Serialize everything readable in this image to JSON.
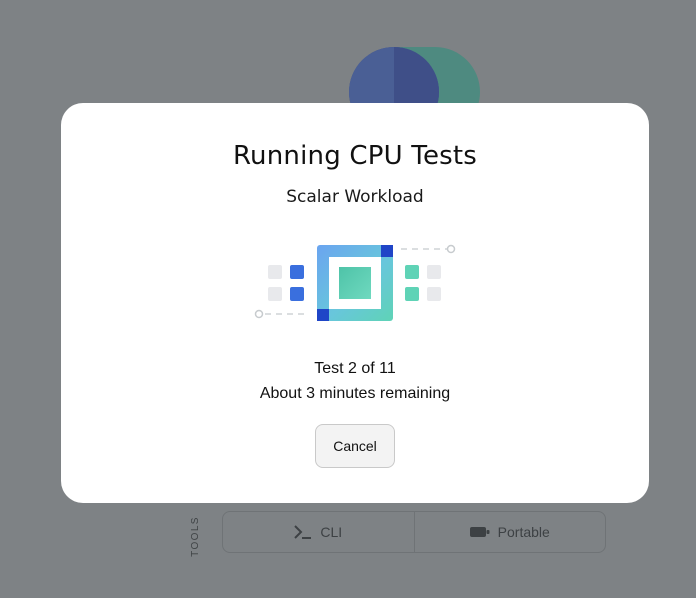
{
  "modal": {
    "title": "Running CPU Tests",
    "subtitle": "Scalar Workload",
    "progress_line": "Test 2 of 11",
    "remaining_line": "About 3 minutes remaining",
    "cancel_label": "Cancel"
  },
  "tools": {
    "label": "TOOLS",
    "buttons": [
      {
        "label": "CLI",
        "icon": "terminal-icon"
      },
      {
        "label": "Portable",
        "icon": "battery-icon"
      }
    ]
  },
  "colors": {
    "overlay": "#7e8285",
    "accent_blue": "#3a6fde",
    "accent_teal": "#5fd3b6",
    "logo_blue": "#4a5f95",
    "logo_teal": "#4e8a80"
  }
}
